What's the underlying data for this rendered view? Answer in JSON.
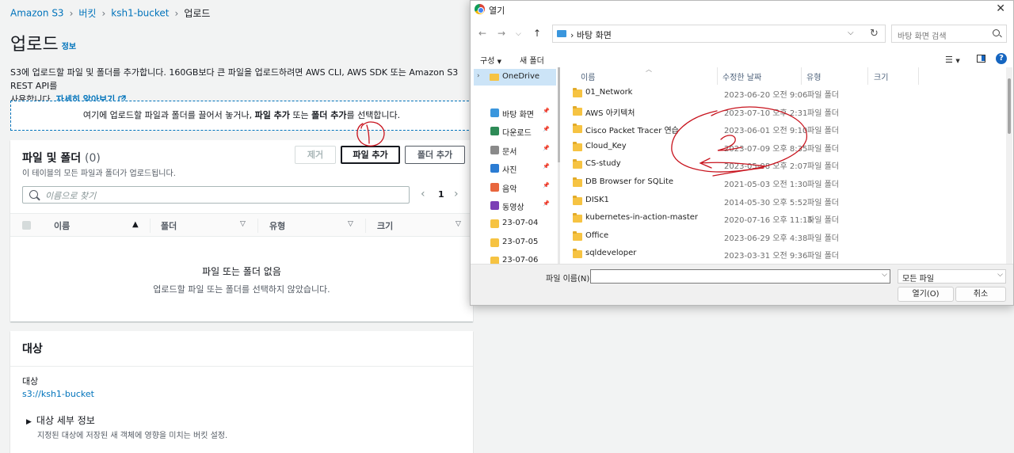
{
  "breadcrumb": {
    "items": [
      "Amazon S3",
      "버킷",
      "ksh1-bucket"
    ],
    "current": "업로드"
  },
  "page": {
    "title": "업로드",
    "info_link": "정보",
    "description": "S3에 업로드할 파일 및 폴더를 추가합니다. 160GB보다 큰 파일을 업로드하려면 AWS CLI, AWS SDK 또는 Amazon S3 REST API를",
    "description_line2": "사용합니다.",
    "learn_more": "자세히 알아보기",
    "dropzone": {
      "before": "여기에 업로드할 파일과 폴더를 끌어서 놓거나, ",
      "add_files": "파일 추가",
      "mid": " 또는 ",
      "add_folder": "폴더 추가",
      "after": "를 선택합니다."
    }
  },
  "files_panel": {
    "title": "파일 및 폴더",
    "count": "(0)",
    "subtitle": "이 테이블의 모든 파일과 폴더가 업로드됩니다.",
    "remove_button": "제거",
    "add_files_button": "파일 추가",
    "add_folder_button": "폴더 추가",
    "search_placeholder": "이름으로 찾기",
    "page_number": "1",
    "columns": [
      "이름",
      "폴더",
      "유형",
      "크기"
    ],
    "empty_title": "파일 또는 폴더 없음",
    "empty_subtitle": "업로드할 파일 또는 폴더를 선택하지 않았습니다."
  },
  "destination_panel": {
    "title": "대상",
    "label": "대상",
    "value": "s3://ksh1-bucket",
    "details_toggle": "대상 세부 정보",
    "details_sub": "지정된 대상에 저장된 새 객체에 영향을 미치는 버킷 설정."
  },
  "dialog": {
    "title": "열기",
    "address": "바탕 화면",
    "search_placeholder": "바탕 화면 검색",
    "organize": "구성",
    "new_folder": "새 폴더",
    "nav_root": "OneDrive",
    "nav_items": [
      {
        "label": "바탕 화면",
        "icon": "desktop-icon",
        "color": "#3a96dd",
        "pinned": true
      },
      {
        "label": "다운로드",
        "icon": "download-icon",
        "color": "#2e8b57",
        "pinned": true
      },
      {
        "label": "문서",
        "icon": "document-icon",
        "color": "#8a8a8a",
        "pinned": true
      },
      {
        "label": "사진",
        "icon": "pictures-icon",
        "color": "#2b7cd3",
        "pinned": true
      },
      {
        "label": "음악",
        "icon": "music-icon",
        "color": "#e8663d",
        "pinned": true
      },
      {
        "label": "동영상",
        "icon": "video-icon",
        "color": "#7b3fb5",
        "pinned": true
      },
      {
        "label": "23-07-04",
        "icon": "folder-icon",
        "color": "#f6c342",
        "pinned": false
      },
      {
        "label": "23-07-05",
        "icon": "folder-icon",
        "color": "#f6c342",
        "pinned": false
      },
      {
        "label": "23-07-06",
        "icon": "folder-icon",
        "color": "#f6c342",
        "pinned": false
      }
    ],
    "columns": [
      "이름",
      "수정한 날짜",
      "유형",
      "크기"
    ],
    "files": [
      {
        "name": "01_Network",
        "date": "2023-06-20 오전 9:06",
        "type": "파일 폴더"
      },
      {
        "name": "AWS 아키텍처",
        "date": "2023-07-10 오후 2:31",
        "type": "파일 폴더"
      },
      {
        "name": "Cisco Packet Tracer 연습",
        "date": "2023-06-01 오전 9:10",
        "type": "파일 폴더"
      },
      {
        "name": "Cloud_Key",
        "date": "2023-07-09 오후 8:35",
        "type": "파일 폴더"
      },
      {
        "name": "CS-study",
        "date": "2023-05-08 오후 2:07",
        "type": "파일 폴더"
      },
      {
        "name": "DB Browser for SQLite",
        "date": "2021-05-03 오전 1:30",
        "type": "파일 폴더"
      },
      {
        "name": "DISK1",
        "date": "2014-05-30 오후 5:52",
        "type": "파일 폴더"
      },
      {
        "name": "kubernetes-in-action-master",
        "date": "2020-07-16 오후 11:15",
        "type": "파일 폴더"
      },
      {
        "name": "Office",
        "date": "2023-06-29 오후 4:38",
        "type": "파일 폴더"
      },
      {
        "name": "sqldeveloper",
        "date": "2023-03-31 오전 9:36",
        "type": "파일 폴더"
      }
    ],
    "filename_label": "파일 이름(N):",
    "filename_value": "",
    "filetype_value": "모든 파일",
    "open_button": "열기(O)",
    "cancel_button": "취소"
  },
  "colors": {
    "aws_link": "#0073bb",
    "annotation_red": "#c8141e",
    "selected_nav": "#cce4f7",
    "folder": "#f6c342"
  }
}
